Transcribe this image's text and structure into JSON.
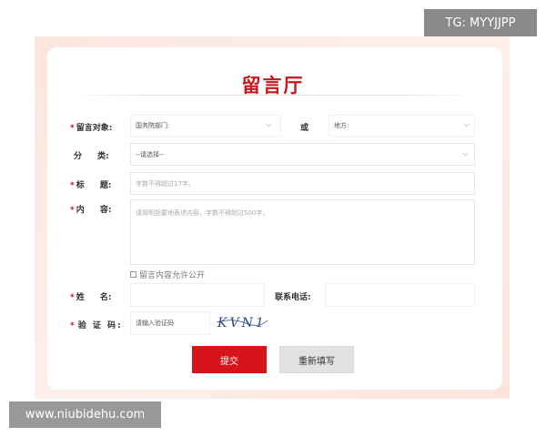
{
  "watermark_top": "TG: MYYJJPP",
  "watermark_bottom": "www.niubidehu.com",
  "form": {
    "title": "留言厅",
    "required_mark": "*",
    "target": {
      "label": "留言对象:",
      "department_value": "国务院部门:",
      "or_label": "或",
      "region_value": "地方:"
    },
    "category": {
      "label": "分 类:",
      "value": "--请选择--"
    },
    "subject": {
      "label": "标 题:",
      "placeholder": "字数不得超过17字。"
    },
    "content": {
      "label": "内 容:",
      "placeholder": "请简明扼要地表述内容，字数不得超过500字。"
    },
    "public_option": "留言内容允许公开",
    "name": {
      "label": "姓 名:"
    },
    "phone": {
      "label": "联系电话:"
    },
    "captcha": {
      "label": "验 证 码:",
      "placeholder": "请输入验证码",
      "image_text": "KVN1"
    },
    "submit_label": "提交",
    "reset_label": "重新填写"
  }
}
